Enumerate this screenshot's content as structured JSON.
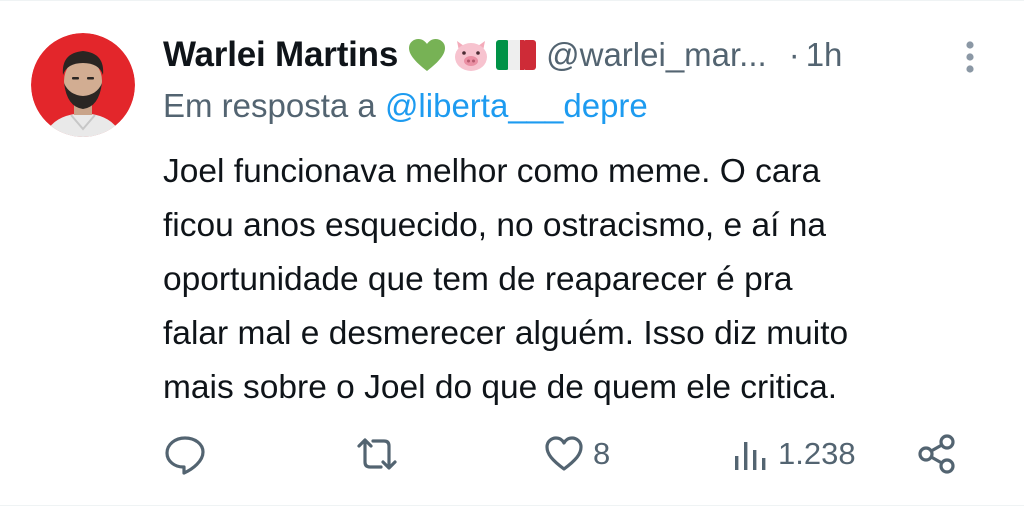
{
  "tweet": {
    "author": {
      "display_name": "Warlei Martins",
      "emojis": [
        "green-heart",
        "pig-face",
        "italy-flag"
      ],
      "handle": "@warlei_mar...",
      "avatar_bg": "#e3262b"
    },
    "separator": "·",
    "time": "1h",
    "reply": {
      "prefix": "Em resposta a ",
      "mention": "@liberta___depre"
    },
    "text_lines": [
      "Joel funcionava melhor como meme. O cara",
      "ficou anos esquecido, no ostracismo, e aí na",
      "oportunidade que tem de reaparecer é pra",
      "falar mal e desmerecer alguém. Isso diz muito",
      "mais sobre o Joel do que de quem ele critica."
    ],
    "actions": {
      "reply_icon": "comment-icon",
      "retweet_icon": "retweet-icon",
      "like_icon": "heart-icon",
      "likes": "8",
      "views_icon": "views-icon",
      "views": "1.238",
      "share_icon": "share-icon"
    },
    "colors": {
      "text": "#0f1419",
      "secondary": "#536471",
      "link": "#1d9bf0"
    }
  }
}
